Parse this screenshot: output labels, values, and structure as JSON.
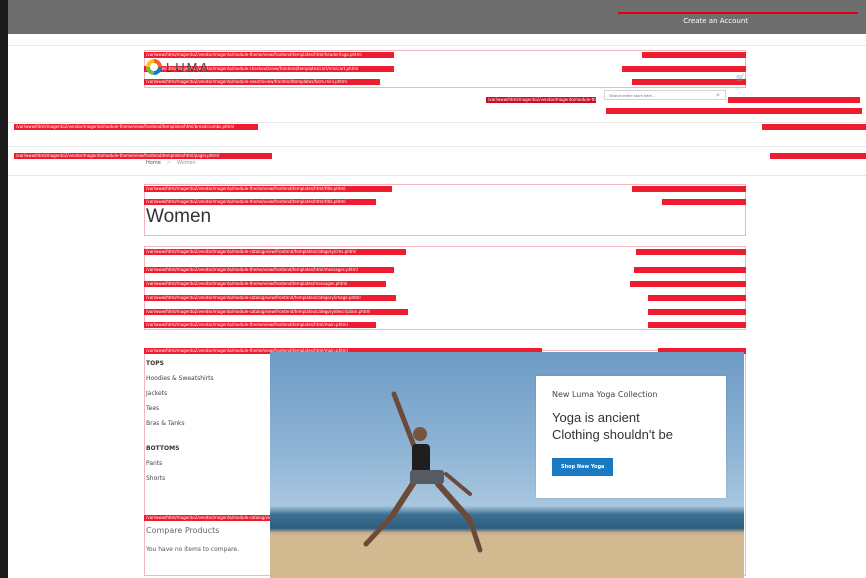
{
  "header": {
    "create_account": "Create an Account",
    "logo_text": "LUMA",
    "search_placeholder": "Search entire store here..."
  },
  "breadcrumbs": {
    "home": "Home",
    "separator": ">",
    "current": "Women"
  },
  "page": {
    "title": "Women"
  },
  "sidebar": {
    "groups": [
      {
        "heading": "TOPS",
        "items": [
          "Hoodies & Sweatshirts",
          "Jackets",
          "Tees",
          "Bras & Tanks"
        ]
      },
      {
        "heading": "BOTTOMS",
        "items": [
          "Pants",
          "Shorts"
        ]
      }
    ],
    "compare_title": "Compare Products",
    "compare_empty": "You have no items to compare."
  },
  "promo": {
    "kicker": "New Luma Yoga Collection",
    "headline_line1": "Yoga is ancient",
    "headline_line2": "Clothing shouldn't be",
    "button": "Shop New Yoga"
  },
  "template_hints": [
    "/var/www/html/magento2/vendor/magento/module-theme/view/frontend/templates/html/header/logo.phtml",
    "/var/www/html/magento2/vendor/magento/module-checkout/view/frontend/templates/cart/minicart.phtml",
    "/var/www/html/magento2/vendor/magento/module-search/view/frontend/templates/form.mini.phtml",
    "/var/www/html/magento2/vendor/magento/module-theme/view/frontend/templates/html/sections.phtml",
    "/var/www/html/magento2/vendor/magento/module-theme/view/frontend/templates/html/breadcrumbs.phtml",
    "/var/www/html/magento2/vendor/magento/module-theme/view/frontend/templates/html/pager.phtml",
    "/var/www/html/magento2/vendor/magento/module-theme/view/frontend/templates/html/title.phtml",
    "/var/www/html/magento2/vendor/magento/module-catalog/view/frontend/templates/category/cms.phtml",
    "/var/www/html/magento2/vendor/magento/module-theme/view/frontend/templates/html/messages.phtml",
    "/var/www/html/magento2/vendor/magento/module-theme/view/frontend/templates/messages.phtml",
    "/var/www/html/magento2/vendor/magento/module-catalog/view/frontend/templates/category/image.phtml",
    "/var/www/html/magento2/vendor/magento/module-catalog/view/frontend/templates/category/description.phtml",
    "/var/www/html/magento2/vendor/magento/module-theme/view/frontend/templates/html/main.phtml",
    "/var/www/html/magento2/vendor/magento/module-catalog/view/frontend/templates/product/compare/sidebar.phtml"
  ],
  "colors": {
    "hint_red": "#ee1c2f",
    "accent_blue": "#1979c3",
    "panel_gray": "#6e6e6e"
  }
}
